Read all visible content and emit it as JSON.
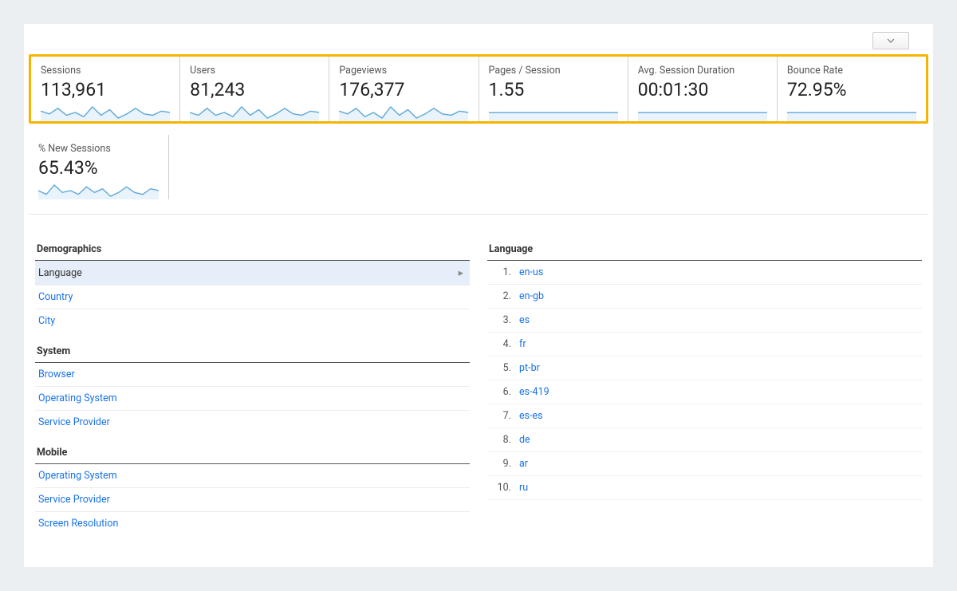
{
  "metrics": {
    "sessions": {
      "label": "Sessions",
      "value": "113,961"
    },
    "users": {
      "label": "Users",
      "value": "81,243"
    },
    "pageviews": {
      "label": "Pageviews",
      "value": "176,377"
    },
    "ppsession": {
      "label": "Pages / Session",
      "value": "1.55"
    },
    "avgduration": {
      "label": "Avg. Session Duration",
      "value": "00:01:30"
    },
    "bouncerate": {
      "label": "Bounce Rate",
      "value": "72.95%"
    },
    "newsessions": {
      "label": "% New Sessions",
      "value": "65.43%"
    }
  },
  "leftnav": {
    "demographics": {
      "header": "Demographics",
      "items": [
        "Language",
        "Country",
        "City"
      ]
    },
    "system": {
      "header": "System",
      "items": [
        "Browser",
        "Operating System",
        "Service Provider"
      ]
    },
    "mobile": {
      "header": "Mobile",
      "items": [
        "Operating System",
        "Service Provider",
        "Screen Resolution"
      ]
    }
  },
  "selected_dimension": "Language",
  "lang_table": {
    "header": "Language",
    "rows": [
      "en-us",
      "en-gb",
      "es",
      "fr",
      "pt-br",
      "es-419",
      "es-es",
      "de",
      "ar",
      "ru"
    ]
  },
  "chart_data": {
    "type": "line",
    "sparklines": {
      "sessions": [
        14,
        12,
        16,
        11,
        13,
        10,
        17,
        11,
        15,
        9,
        12,
        16,
        12,
        11,
        14,
        13
      ],
      "users": [
        12,
        10,
        15,
        10,
        12,
        9,
        16,
        10,
        14,
        8,
        11,
        15,
        11,
        10,
        13,
        12
      ],
      "pageviews": [
        16,
        14,
        18,
        12,
        15,
        11,
        19,
        13,
        17,
        11,
        14,
        18,
        14,
        13,
        16,
        15
      ],
      "newsessions": [
        11,
        9,
        14,
        10,
        11,
        9,
        13,
        10,
        12,
        8,
        10,
        13,
        10,
        9,
        12,
        11
      ]
    },
    "flats": {
      "ppsession": 1.55,
      "avgduration": 90,
      "bouncerate": 72.95
    }
  },
  "colors": {
    "accent": "#f5b400",
    "link": "#1a73e8",
    "sparkline": "#5ea7d8",
    "sparkfill": "#e9f3fb"
  }
}
